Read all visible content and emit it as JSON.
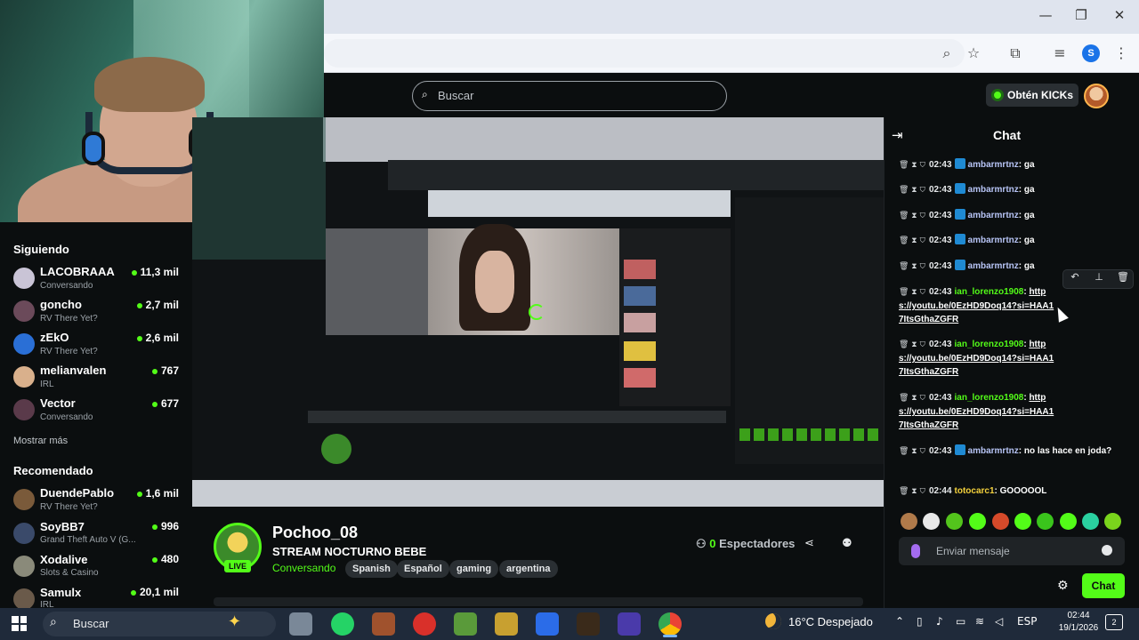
{
  "browser": {
    "window_controls": [
      "—",
      "❐",
      "✕"
    ],
    "toolbar_icons": [
      "zoom-icon",
      "star-icon",
      "extensions-icon",
      "media-icon",
      "profile-icon",
      "menu-icon"
    ],
    "profile_initial": "S"
  },
  "header": {
    "search_placeholder": "Buscar",
    "kicks_label": "Obtén KICKs"
  },
  "sidebar": {
    "following_title": "Siguiendo",
    "following": [
      {
        "name": "LACOBRAAA",
        "sub": "Conversando",
        "count": "11,3 mil",
        "color": "#c9c4d6"
      },
      {
        "name": "goncho",
        "sub": "RV There Yet?",
        "count": "2,7 mil",
        "color": "#6b4a5a"
      },
      {
        "name": "zEkO",
        "sub": "RV There Yet?",
        "count": "2,6 mil",
        "color": "#2a6fd6"
      },
      {
        "name": "melianvalen",
        "sub": "IRL",
        "count": "767",
        "color": "#d9b08c"
      },
      {
        "name": "Vector",
        "sub": "Conversando",
        "count": "677",
        "color": "#5a3a4a"
      }
    ],
    "show_more": "Mostrar más",
    "recommended_title": "Recomendado",
    "recommended": [
      {
        "name": "DuendePablo",
        "sub": "RV There Yet?",
        "count": "1,6 mil",
        "color": "#7a5a3a"
      },
      {
        "name": "SoyBB7",
        "sub": "Grand Theft Auto V (G...",
        "count": "996",
        "color": "#3a4a6a"
      },
      {
        "name": "Xodalive",
        "sub": "Slots & Casino",
        "count": "480",
        "color": "#8a8a7a"
      },
      {
        "name": "Samulx",
        "sub": "IRL",
        "count": "20,1 mil",
        "color": "#6a5a4a"
      }
    ]
  },
  "stream": {
    "streamer": "Pochoo_08",
    "live_label": "LIVE",
    "title": "STREAM NOCTURNO BEBE",
    "category": "Conversando",
    "tags": [
      "Spanish",
      "Español",
      "gaming",
      "argentina"
    ],
    "viewers_count": "0",
    "viewers_label": "Espectadores"
  },
  "chat": {
    "title": "Chat",
    "messages": [
      {
        "time": "02:43",
        "user": "ambarmrtnz",
        "text": "ga",
        "kind": "amb"
      },
      {
        "time": "02:43",
        "user": "ambarmrtnz",
        "text": "ga",
        "kind": "amb"
      },
      {
        "time": "02:43",
        "user": "ambarmrtnz",
        "text": "ga",
        "kind": "amb"
      },
      {
        "time": "02:43",
        "user": "ambarmrtnz",
        "text": "ga",
        "kind": "amb"
      },
      {
        "time": "02:43",
        "user": "ambarmrtnz",
        "text": "ga",
        "kind": "amb"
      },
      {
        "time": "02:43",
        "user": "ian_lorenzo1908",
        "text": "https://youtu.be/0EzHD9Doq14?si=HAA17ItsGthaZGFR",
        "kind": "ian"
      },
      {
        "time": "02:43",
        "user": "ian_lorenzo1908",
        "text": "https://youtu.be/0EzHD9Doq14?si=HAA17ItsGthaZGFR",
        "kind": "ian"
      },
      {
        "time": "02:43",
        "user": "ian_lorenzo1908",
        "text": "https://youtu.be/0EzHD9Doq14?si=HAA17ItsGthaZGFR",
        "kind": "ian"
      },
      {
        "time": "02:43",
        "user": "ambarmrtnz",
        "text": "no las hace en joda?",
        "kind": "amb"
      },
      {
        "time": "02:44",
        "user": "totocarc1",
        "text": "GOOOOOL",
        "kind": "tot"
      }
    ],
    "input_placeholder": "Enviar mensaje",
    "send_label": "Chat",
    "emote_colors": [
      "#b07a4a",
      "#e8e8e8",
      "#53c41c",
      "#53fc18",
      "#d64a2a",
      "#53fc18",
      "#3ac41c",
      "#53fc18",
      "#2ad0a0",
      "#7ad41c"
    ]
  },
  "taskbar": {
    "search_placeholder": "Buscar",
    "weather": "16°C  Despejado",
    "language": "ESP",
    "time": "02:44",
    "date": "19/1/2026",
    "notifications": "2",
    "app_colors": [
      "#7a8898",
      "#25d366",
      "#a0522d",
      "#d9302a",
      "#5a9a3a",
      "#c8a030",
      "#2b6ce8",
      "#3a2a1a",
      "#4a3aaa",
      "#e8e8e8"
    ]
  }
}
